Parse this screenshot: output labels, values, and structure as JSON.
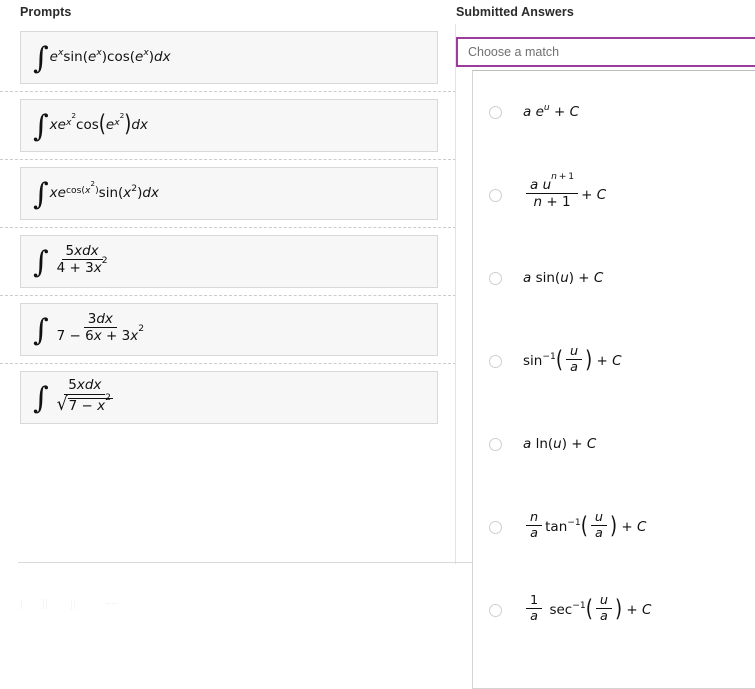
{
  "columns": {
    "prompts_header": "Prompts",
    "answers_header": "Submitted Answers"
  },
  "select": {
    "placeholder": "Choose a match",
    "value": "",
    "border_color": "#9c3d9c"
  },
  "prompts": [
    {
      "id": "prompt-1",
      "latex": "\\int e^{x}\\sin(e^{x})\\cos(e^{x})dx",
      "plain": "∫ e^x sin(e^x) cos(e^x) dx",
      "parts": {
        "integral": "∫",
        "e": "e",
        "exp1": "x",
        "sin": "sin",
        "cos": "cos",
        "dx": "dx"
      }
    },
    {
      "id": "prompt-2",
      "latex": "\\int xe^{x^{2}}\\cos\\left(e^{x^{2}}\\right)dx",
      "plain": "∫ x e^(x²) cos(e^(x²)) dx",
      "parts": {
        "integral": "∫",
        "x": "x",
        "e": "e",
        "exp1": "x",
        "exp2": "2",
        "cos": "cos",
        "dx": "dx"
      }
    },
    {
      "id": "prompt-3",
      "latex": "\\int xe^{\\cos(x^{2})}\\sin(x^{2})dx",
      "plain": "∫ x e^(cos(x²)) sin(x²) dx",
      "parts": {
        "integral": "∫",
        "x": "x",
        "e": "e",
        "cos": "cos",
        "exp_inner": "x",
        "exp_pow": "2",
        "sin": "sin",
        "dx": "dx"
      }
    },
    {
      "id": "prompt-4",
      "latex": "\\int \\frac{5xdx}{4+3x^{2}}",
      "plain": "∫ 5xdx / (4 + 3x²)",
      "parts": {
        "integral": "∫",
        "numerator": "5xdx",
        "denominator": "4 + 3x",
        "den_pow": "2"
      }
    },
    {
      "id": "prompt-5",
      "latex": "\\int \\frac{3dx}{7-6x+3x^{2}}",
      "plain": "∫ 3dx / (7 − 6x + 3x²)",
      "parts": {
        "integral": "∫",
        "numerator": "3dx",
        "denominator": "7 − 6x + 3x",
        "den_pow": "2"
      }
    },
    {
      "id": "prompt-6",
      "latex": "\\int \\frac{5xdx}{\\sqrt{7-x^{2}}}",
      "plain": "∫ 5xdx / √(7 − x²)",
      "parts": {
        "integral": "∫",
        "numerator": "5xdx",
        "radical": "√",
        "radicand": "7 − x",
        "rad_pow": "2"
      }
    }
  ],
  "options": [
    {
      "id": "option-1",
      "latex": "a\\,e^{u}+C",
      "plain": "a e^u + C",
      "parts": {
        "a": "a",
        "e": "e",
        "u": "u",
        "plusC": "+ C"
      }
    },
    {
      "id": "option-2",
      "latex": "\\frac{a\\,u^{n+1}}{n+1}+C",
      "plain": "a u^(n+1) / (n+1) + C",
      "parts": {
        "num": "a u",
        "num_exp": "n + 1",
        "den": "n + 1",
        "plusC": "+ C"
      }
    },
    {
      "id": "option-3",
      "latex": "a\\sin(u)+C",
      "plain": "a sin(u) + C",
      "parts": {
        "a": "a",
        "fn": "sin",
        "arg": "u",
        "plusC": "+ C"
      }
    },
    {
      "id": "option-4",
      "latex": "\\sin^{-1}\\left(\\frac{u}{a}\\right)+C",
      "plain": "sin⁻¹(u/a) + C",
      "parts": {
        "fn": "sin",
        "exp": "−1",
        "num": "u",
        "den": "a",
        "plusC": "+ C"
      }
    },
    {
      "id": "option-5",
      "latex": "a\\ln(u)+C",
      "plain": "a ln(u) + C",
      "parts": {
        "a": "a",
        "fn": "ln",
        "arg": "u",
        "plusC": "+ C"
      }
    },
    {
      "id": "option-6",
      "latex": "\\frac{n}{a}\\tan^{-1}\\left(\\frac{u}{a}\\right)+C",
      "plain": "(n/a) tan⁻¹(u/a) + C",
      "parts": {
        "coef_num": "n",
        "coef_den": "a",
        "fn": "tan",
        "exp": "−1",
        "num": "u",
        "den": "a",
        "plusC": "+ C"
      }
    },
    {
      "id": "option-7",
      "latex": "\\frac{1}{a}\\sec^{-1}\\left(\\frac{u}{a}\\right)+C",
      "plain": "(1/a) sec⁻¹(u/a) + C",
      "parts": {
        "coef_num": "1",
        "coef_den": "a",
        "fn": "sec",
        "exp": "−1",
        "num": "u",
        "den": "a",
        "plusC": "+ C"
      }
    }
  ]
}
